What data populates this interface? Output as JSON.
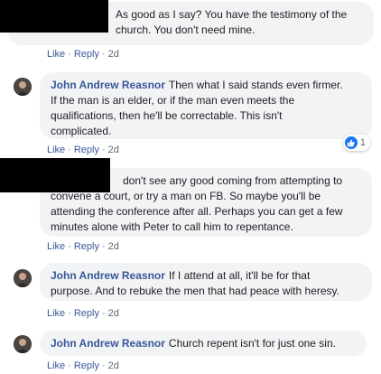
{
  "comments": [
    {
      "author": "",
      "text": "As good as I say? You have the testimony of the\nchurch. You don't need mine.",
      "like_label": "Like",
      "reply_label": "Reply",
      "time": "2d"
    },
    {
      "author": "John Andrew Reasnor",
      "text": "Then what I said stands even firmer.\nIf the man is an elder, or if the man even meets the\nqualifications, then he'll be correctable. This isn't\ncomplicated.",
      "like_label": "Like",
      "reply_label": "Reply",
      "time": "2d",
      "reaction_icon": "thumbs-up-icon",
      "reaction_count": "1"
    },
    {
      "author": "",
      "text": "don't see any good coming from attempting to\nconvene a court, or try a man on FB. So maybe you'll be\nattending the conference after all. Perhaps you can get a few\nminutes alone with Peter to call him to repentance.",
      "like_label": "Like",
      "reply_label": "Reply",
      "time": "2d"
    },
    {
      "author": "John Andrew Reasnor",
      "text": "If I attend at all, it'll be for that\npurpose. And to rebuke the men that had peace with heresy.",
      "like_label": "Like",
      "reply_label": "Reply",
      "time": "2d"
    },
    {
      "author": "John Andrew Reasnor",
      "text": "Church repent isn't for just one sin.",
      "like_label": "Like",
      "reply_label": "Reply",
      "time": "2d"
    }
  ],
  "colors": {
    "name": "#385898",
    "bubble": "#f2f3f5",
    "meta": "#606770",
    "like_badge": "#1877f2"
  }
}
